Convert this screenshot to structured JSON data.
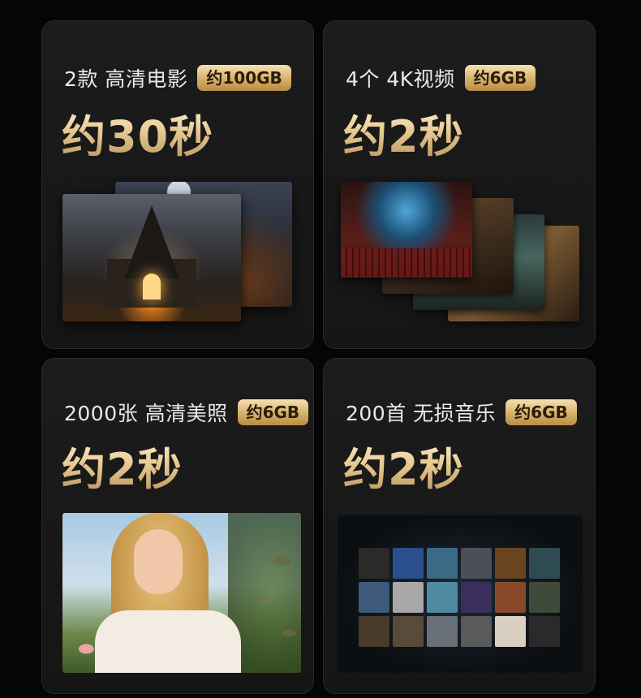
{
  "cards": [
    {
      "label": "2款 高清电影",
      "badge": "约100GB",
      "time": "约30秒"
    },
    {
      "label": "4个 4K视频",
      "badge": "约6GB",
      "time": "约2秒"
    },
    {
      "label": "2000张 高清美照",
      "badge": "约6GB",
      "time": "约2秒"
    },
    {
      "label": "200首 无损音乐",
      "badge": "约6GB",
      "time": "约2秒"
    }
  ],
  "colors": {
    "background": "#050505",
    "card": "#1a1a1a",
    "gold": "#d6b06a"
  }
}
